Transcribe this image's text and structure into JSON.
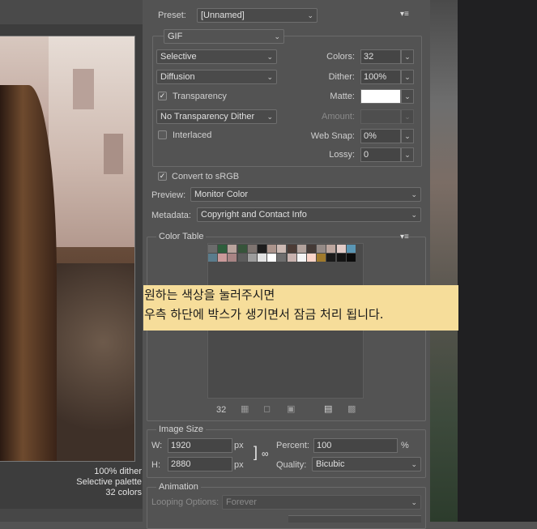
{
  "preset": {
    "label": "Preset:",
    "value": "[Unnamed]"
  },
  "format": {
    "value": "GIF"
  },
  "options": {
    "reduction": "Selective",
    "dither_algo": "Diffusion",
    "transparency_label": "Transparency",
    "transparency_checked": true,
    "no_transparency_dither": "No Transparency Dither",
    "interlaced_label": "Interlaced",
    "interlaced_checked": false,
    "colors_label": "Colors:",
    "colors_value": "32",
    "dither_label": "Dither:",
    "dither_value": "100%",
    "matte_label": "Matte:",
    "matte_color": "#ffffff",
    "amount_label": "Amount:",
    "web_snap_label": "Web Snap:",
    "web_snap_value": "0%",
    "lossy_label": "Lossy:",
    "lossy_value": "0"
  },
  "convert": {
    "label": "Convert to sRGB",
    "checked": true
  },
  "preview_row": {
    "label": "Preview:",
    "value": "Monitor Color"
  },
  "metadata_row": {
    "label": "Metadata:",
    "value": "Copyright and Contact Info"
  },
  "color_table": {
    "title": "Color Table",
    "count": "32",
    "swatches_row1": [
      "#6b6b6b",
      "#2e5e3c",
      "#b9a39c",
      "#36543a",
      "#7e7470",
      "#1d1d1d",
      "#ab948c",
      "#cdbab4",
      "#4c3c36",
      "#b2a29c",
      "#443a36",
      "#948a86",
      "#bca69e",
      "#e2ccc8",
      "#5a96b4"
    ],
    "swatches_row2": [
      "#5a7c8c",
      "#ca9a9a",
      "#a88484",
      "#5c5c5c",
      "#9c9c9c",
      "#e2e2e2",
      "#ffffff",
      "#6e6e6e",
      "#c8b2ae",
      "#f4f4f4",
      "#fad4c8",
      "#a07a2c",
      "#1a1a1a",
      "#141414",
      "#0c0c0c"
    ]
  },
  "note": {
    "line1": "원하는 색상을 눌러주시면",
    "line2": "우측 하단에 박스가 생기면서 잠금 처리 됩니다."
  },
  "image_size": {
    "title": "Image Size",
    "w_label": "W:",
    "w_value": "1920",
    "h_label": "H:",
    "h_value": "2880",
    "unit": "px",
    "percent_label": "Percent:",
    "percent_value": "100",
    "percent_unit": "%",
    "quality_label": "Quality:",
    "quality_value": "Bicubic"
  },
  "animation": {
    "title": "Animation",
    "looping_label": "Looping Options:",
    "looping_value": "Forever"
  },
  "preview_info": {
    "line1": "100% dither",
    "line2": "Selective palette",
    "line3": "32 colors"
  }
}
